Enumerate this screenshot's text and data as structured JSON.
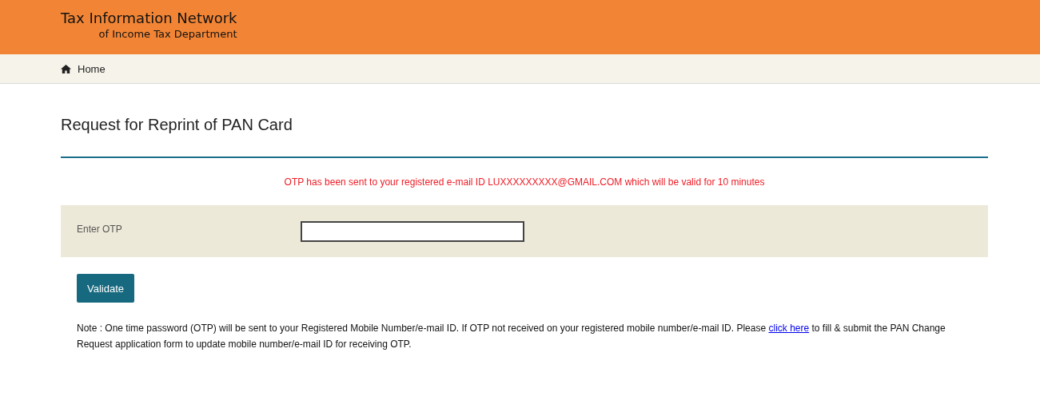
{
  "header": {
    "title": "Tax Information Network",
    "subtitle": "of Income Tax Department"
  },
  "nav": {
    "items": [
      {
        "label": "Home"
      }
    ]
  },
  "page_title": "Request for Reprint of PAN Card",
  "message": "OTP has been sent to your registered e-mail ID LUXXXXXXXXX@GMAIL.COM which will be valid for 10 minutes",
  "form": {
    "label": "Enter OTP"
  },
  "button": "Validate",
  "note": {
    "before": "Note : One time password (OTP) will be sent to your Registered Mobile Number/e-mail ID. If OTP not received on your registered mobile number/e-mail ID. Please ",
    "link": "click here",
    "after": " to fill & submit the PAN Change Request application form to update mobile number/e-mail ID for receiving OTP."
  }
}
